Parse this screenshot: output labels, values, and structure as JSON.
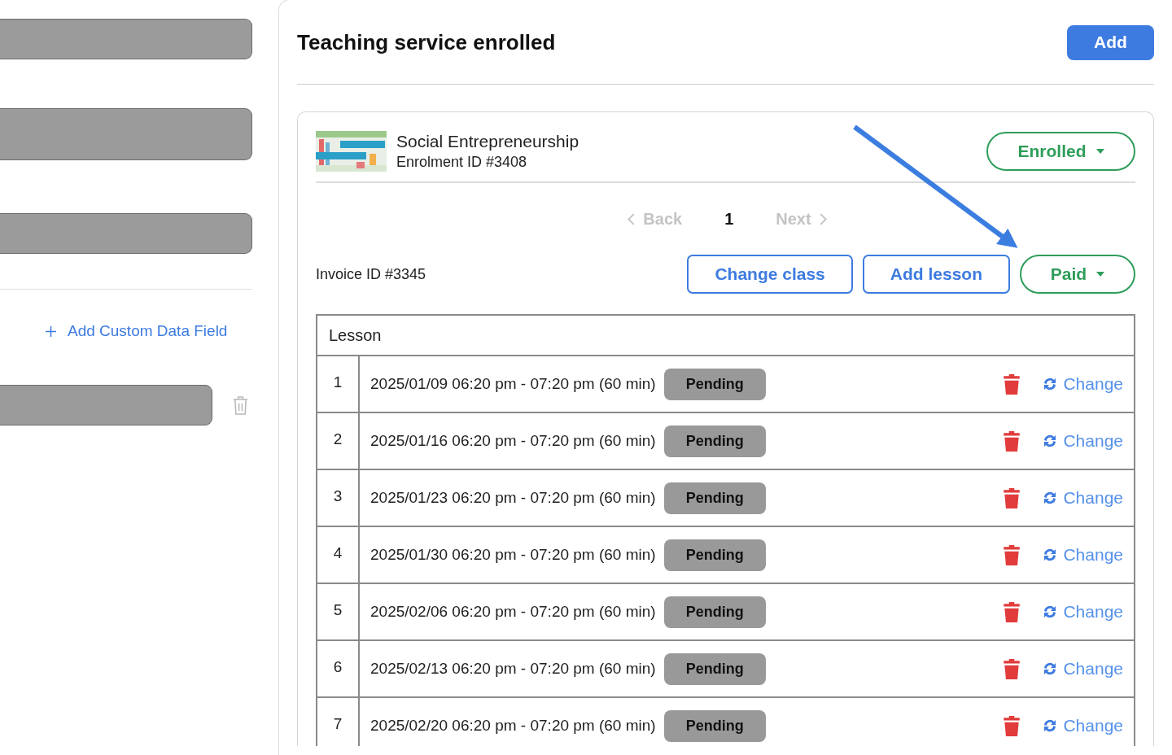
{
  "left_panel": {
    "add_field_link": "Add Custom Data Field"
  },
  "section": {
    "title": "Teaching service enrolled",
    "add_button": "Add"
  },
  "enrolment": {
    "course": "Social Entrepreneurship",
    "enrolment_id": "Enrolment ID #3408",
    "status_dropdown": {
      "label": "Enrolled"
    }
  },
  "pagination": {
    "back": {
      "label": "Back",
      "disabled": true
    },
    "page": "1",
    "next": {
      "label": "Next",
      "disabled": true
    }
  },
  "invoice": {
    "id": "Invoice ID #3345",
    "buttons": [
      "Change class",
      "Add lesson"
    ],
    "payment_dropdown": {
      "label": "Paid"
    }
  },
  "table": {
    "columns": [
      "Lesson"
    ],
    "rows": [
      {
        "number": "1",
        "time": "2025/01/09 06:20 pm - 07:20 pm (60 min)",
        "status": "Pending",
        "action": "Change"
      },
      {
        "number": "2",
        "time": "2025/01/16 06:20 pm - 07:20 pm (60 min)",
        "status": "Pending",
        "action": "Change"
      },
      {
        "number": "3",
        "time": "2025/01/23 06:20 pm - 07:20 pm (60 min)",
        "status": "Pending",
        "action": "Change"
      },
      {
        "number": "4",
        "time": "2025/01/30 06:20 pm - 07:20 pm (60 min)",
        "status": "Pending",
        "action": "Change"
      },
      {
        "number": "5",
        "time": "2025/02/06 06:20 pm - 07:20 pm (60 min)",
        "status": "Pending",
        "action": "Change"
      },
      {
        "number": "6",
        "time": "2025/02/13 06:20 pm - 07:20 pm (60 min)",
        "status": "Pending",
        "action": "Change"
      },
      {
        "number": "7",
        "time": "2025/02/20 06:20 pm - 07:20 pm (60 min)",
        "status": "Pending",
        "action": "Change"
      }
    ]
  }
}
